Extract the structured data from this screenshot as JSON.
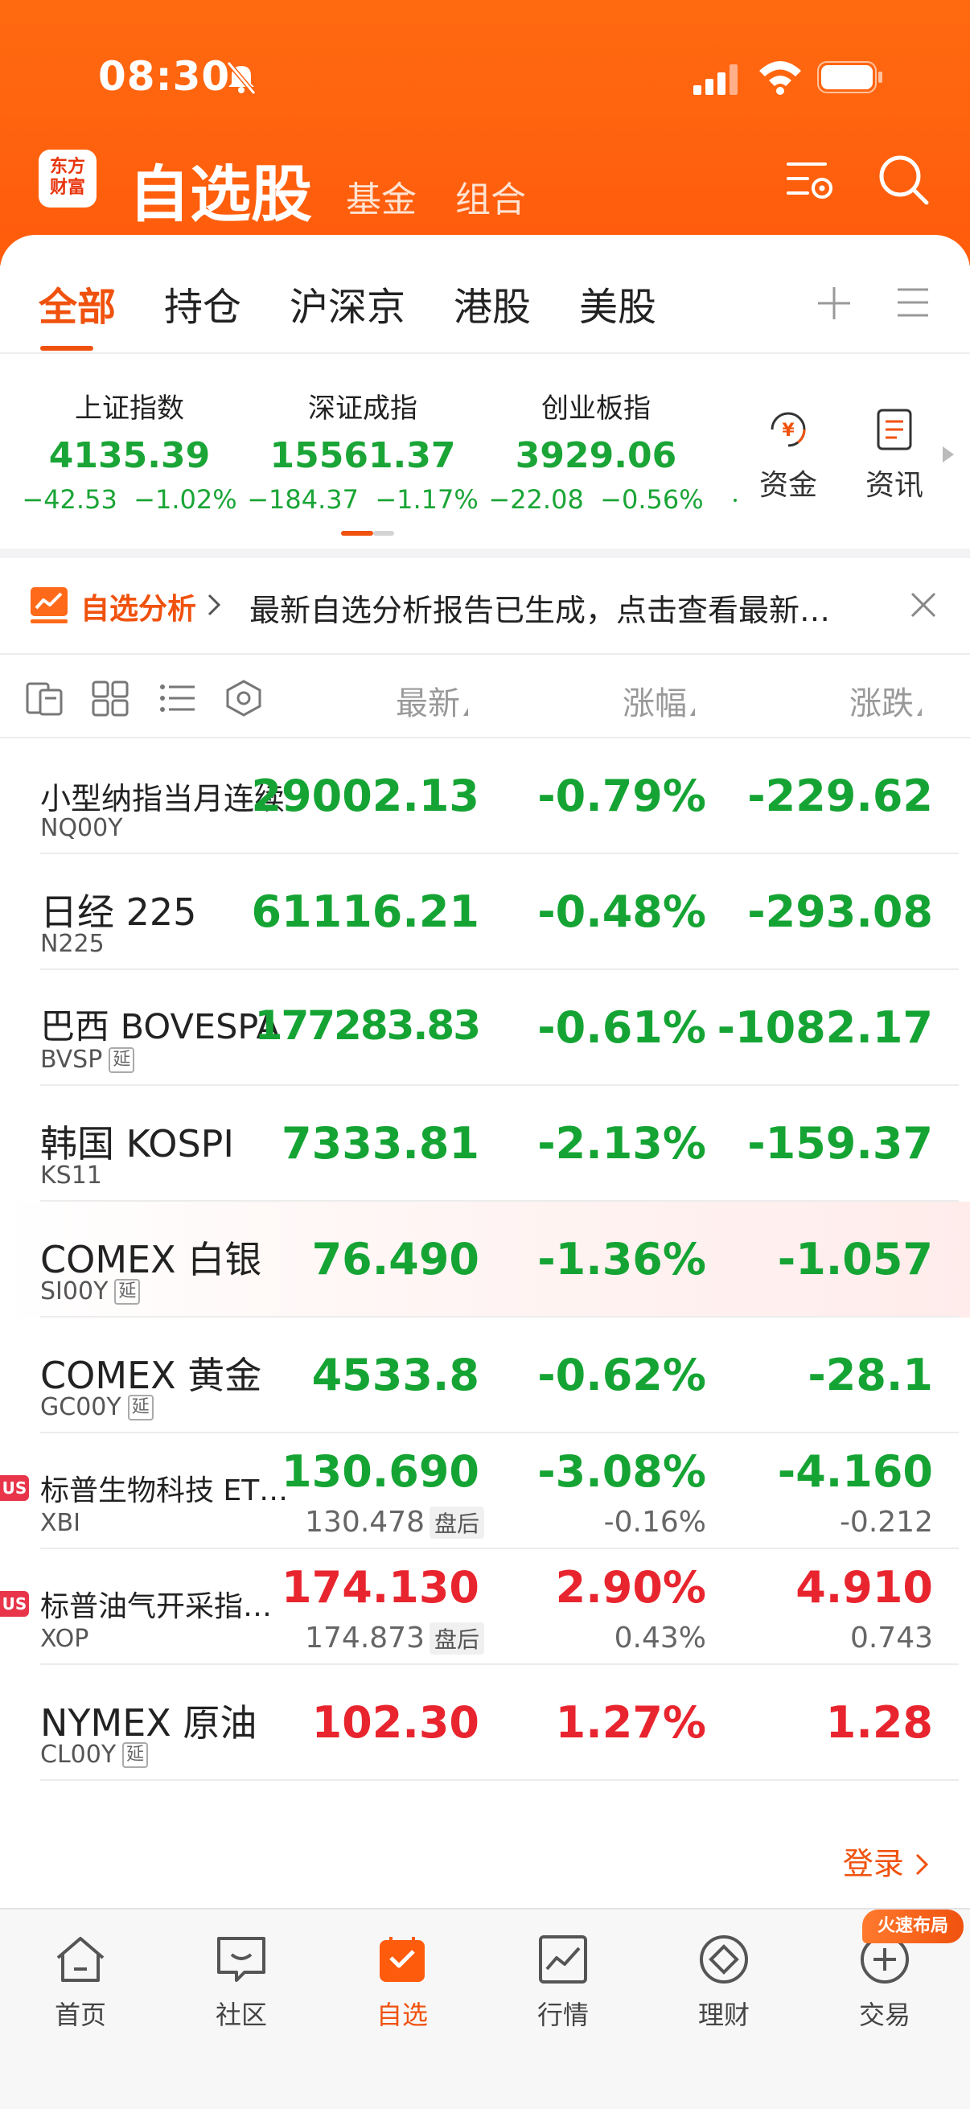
{
  "status_bar": {
    "time": "08:30"
  },
  "header": {
    "logo_line1": "东方",
    "logo_line2": "财富",
    "title": "自选股",
    "tabs": [
      "基金",
      "组合"
    ]
  },
  "category_tabs": {
    "items": [
      "全部",
      "持仓",
      "沪深京",
      "港股",
      "美股"
    ],
    "active_index": 0
  },
  "indices": [
    {
      "name": "上证指数",
      "value": "4135.39",
      "change": "−42.53",
      "percent": "−1.02%"
    },
    {
      "name": "深证成指",
      "value": "15561.37",
      "change": "−184.37",
      "percent": "−1.17%"
    },
    {
      "name": "创业板指",
      "value": "3929.06",
      "change": "−22.08",
      "percent": "−0.56%"
    }
  ],
  "quick_links": [
    {
      "label": "资金",
      "icon": "yuan-circle-icon"
    },
    {
      "label": "资讯",
      "icon": "news-doc-icon"
    }
  ],
  "analysis_banner": {
    "tag": "自选分析",
    "text": "最新自选分析报告已生成，点击查看最新…"
  },
  "list_header": {
    "columns": [
      "最新",
      "涨幅",
      "涨跌"
    ]
  },
  "rows": [
    {
      "name": "小型纳指当月连续",
      "code": "NQ00Y",
      "delay": "",
      "price": "29002.13",
      "pct": "-0.79%",
      "chg": "-229.62",
      "dir": "down"
    },
    {
      "name": "日经 225",
      "code": "N225",
      "delay": "",
      "price": "61116.21",
      "pct": "-0.48%",
      "chg": "-293.08",
      "dir": "down"
    },
    {
      "name": "巴西 BOVESPA",
      "code": "BVSP",
      "delay": "延",
      "price": "177283.83",
      "pct": "-0.61%",
      "chg": "-1082.17",
      "dir": "down"
    },
    {
      "name": "韩国 KOSPI",
      "code": "KS11",
      "delay": "",
      "price": "7333.81",
      "pct": "-2.13%",
      "chg": "-159.37",
      "dir": "down"
    },
    {
      "name": "COMEX 白银",
      "code": "SI00Y",
      "delay": "延",
      "price": "76.490",
      "pct": "-1.36%",
      "chg": "-1.057",
      "dir": "down"
    },
    {
      "name": "COMEX 黄金",
      "code": "GC00Y",
      "delay": "延",
      "price": "4533.8",
      "pct": "-0.62%",
      "chg": "-28.1",
      "dir": "down"
    },
    {
      "name": "标普生物科技 ET…",
      "code": "XBI",
      "badge": "US",
      "price": "130.690",
      "pct": "-3.08%",
      "chg": "-4.160",
      "dir": "down",
      "after_price": "130.478",
      "after_tag": "盘后",
      "after_pct": "-0.16%",
      "after_chg": "-0.212"
    },
    {
      "name": "标普油气开采指…",
      "code": "XOP",
      "badge": "US",
      "price": "174.130",
      "pct": "2.90%",
      "chg": "4.910",
      "dir": "up",
      "after_price": "174.873",
      "after_tag": "盘后",
      "after_pct": "0.43%",
      "after_chg": "0.743"
    },
    {
      "name": "NYMEX 原油",
      "code": "CL00Y",
      "delay": "延",
      "price": "102.30",
      "pct": "1.27%",
      "chg": "1.28",
      "dir": "up"
    }
  ],
  "login": {
    "label": "登录"
  },
  "promo_badge": "火速布局",
  "bottom_nav": [
    {
      "label": "首页",
      "icon": "home-icon"
    },
    {
      "label": "社区",
      "icon": "community-icon"
    },
    {
      "label": "自选",
      "icon": "watchlist-icon",
      "active": true
    },
    {
      "label": "行情",
      "icon": "market-chart-icon"
    },
    {
      "label": "理财",
      "icon": "wealth-icon"
    },
    {
      "label": "交易",
      "icon": "trade-icon"
    }
  ],
  "colors": {
    "brand": "#ff5b0c",
    "accent": "#f0520e",
    "down": "#15a434",
    "up": "#e8252e"
  }
}
